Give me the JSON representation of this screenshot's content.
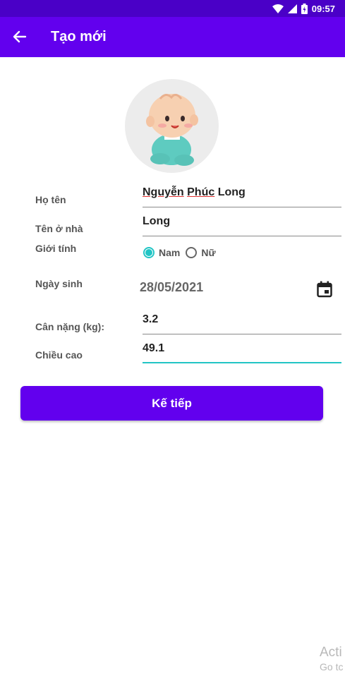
{
  "status_bar": {
    "time": "09:57"
  },
  "app_bar": {
    "title": "Tạo mới"
  },
  "form": {
    "full_name": {
      "label": "Họ tên",
      "value_part1": "Nguyễn",
      "value_part2": " ",
      "value_part3": "Phúc",
      "value_part4": " Long"
    },
    "nickname": {
      "label": "Tên ở nhà",
      "value": "Long"
    },
    "gender": {
      "label": "Giới tính",
      "options": [
        "Nam",
        "Nữ"
      ],
      "selected": "Nam"
    },
    "birthday": {
      "label": "Ngày sinh",
      "value": "28/05/2021"
    },
    "weight": {
      "label": "Cân nặng (kg):",
      "value": "3.2"
    },
    "height": {
      "label": "Chiều cao",
      "value": "49.1"
    }
  },
  "next_button": {
    "label": "Kế tiếp"
  },
  "watermark": {
    "line1": "Acti",
    "line2": "Go tc"
  },
  "colors": {
    "primary": "#6200ee",
    "status_bar": "#4a00c7",
    "accent": "#22c5c5"
  }
}
